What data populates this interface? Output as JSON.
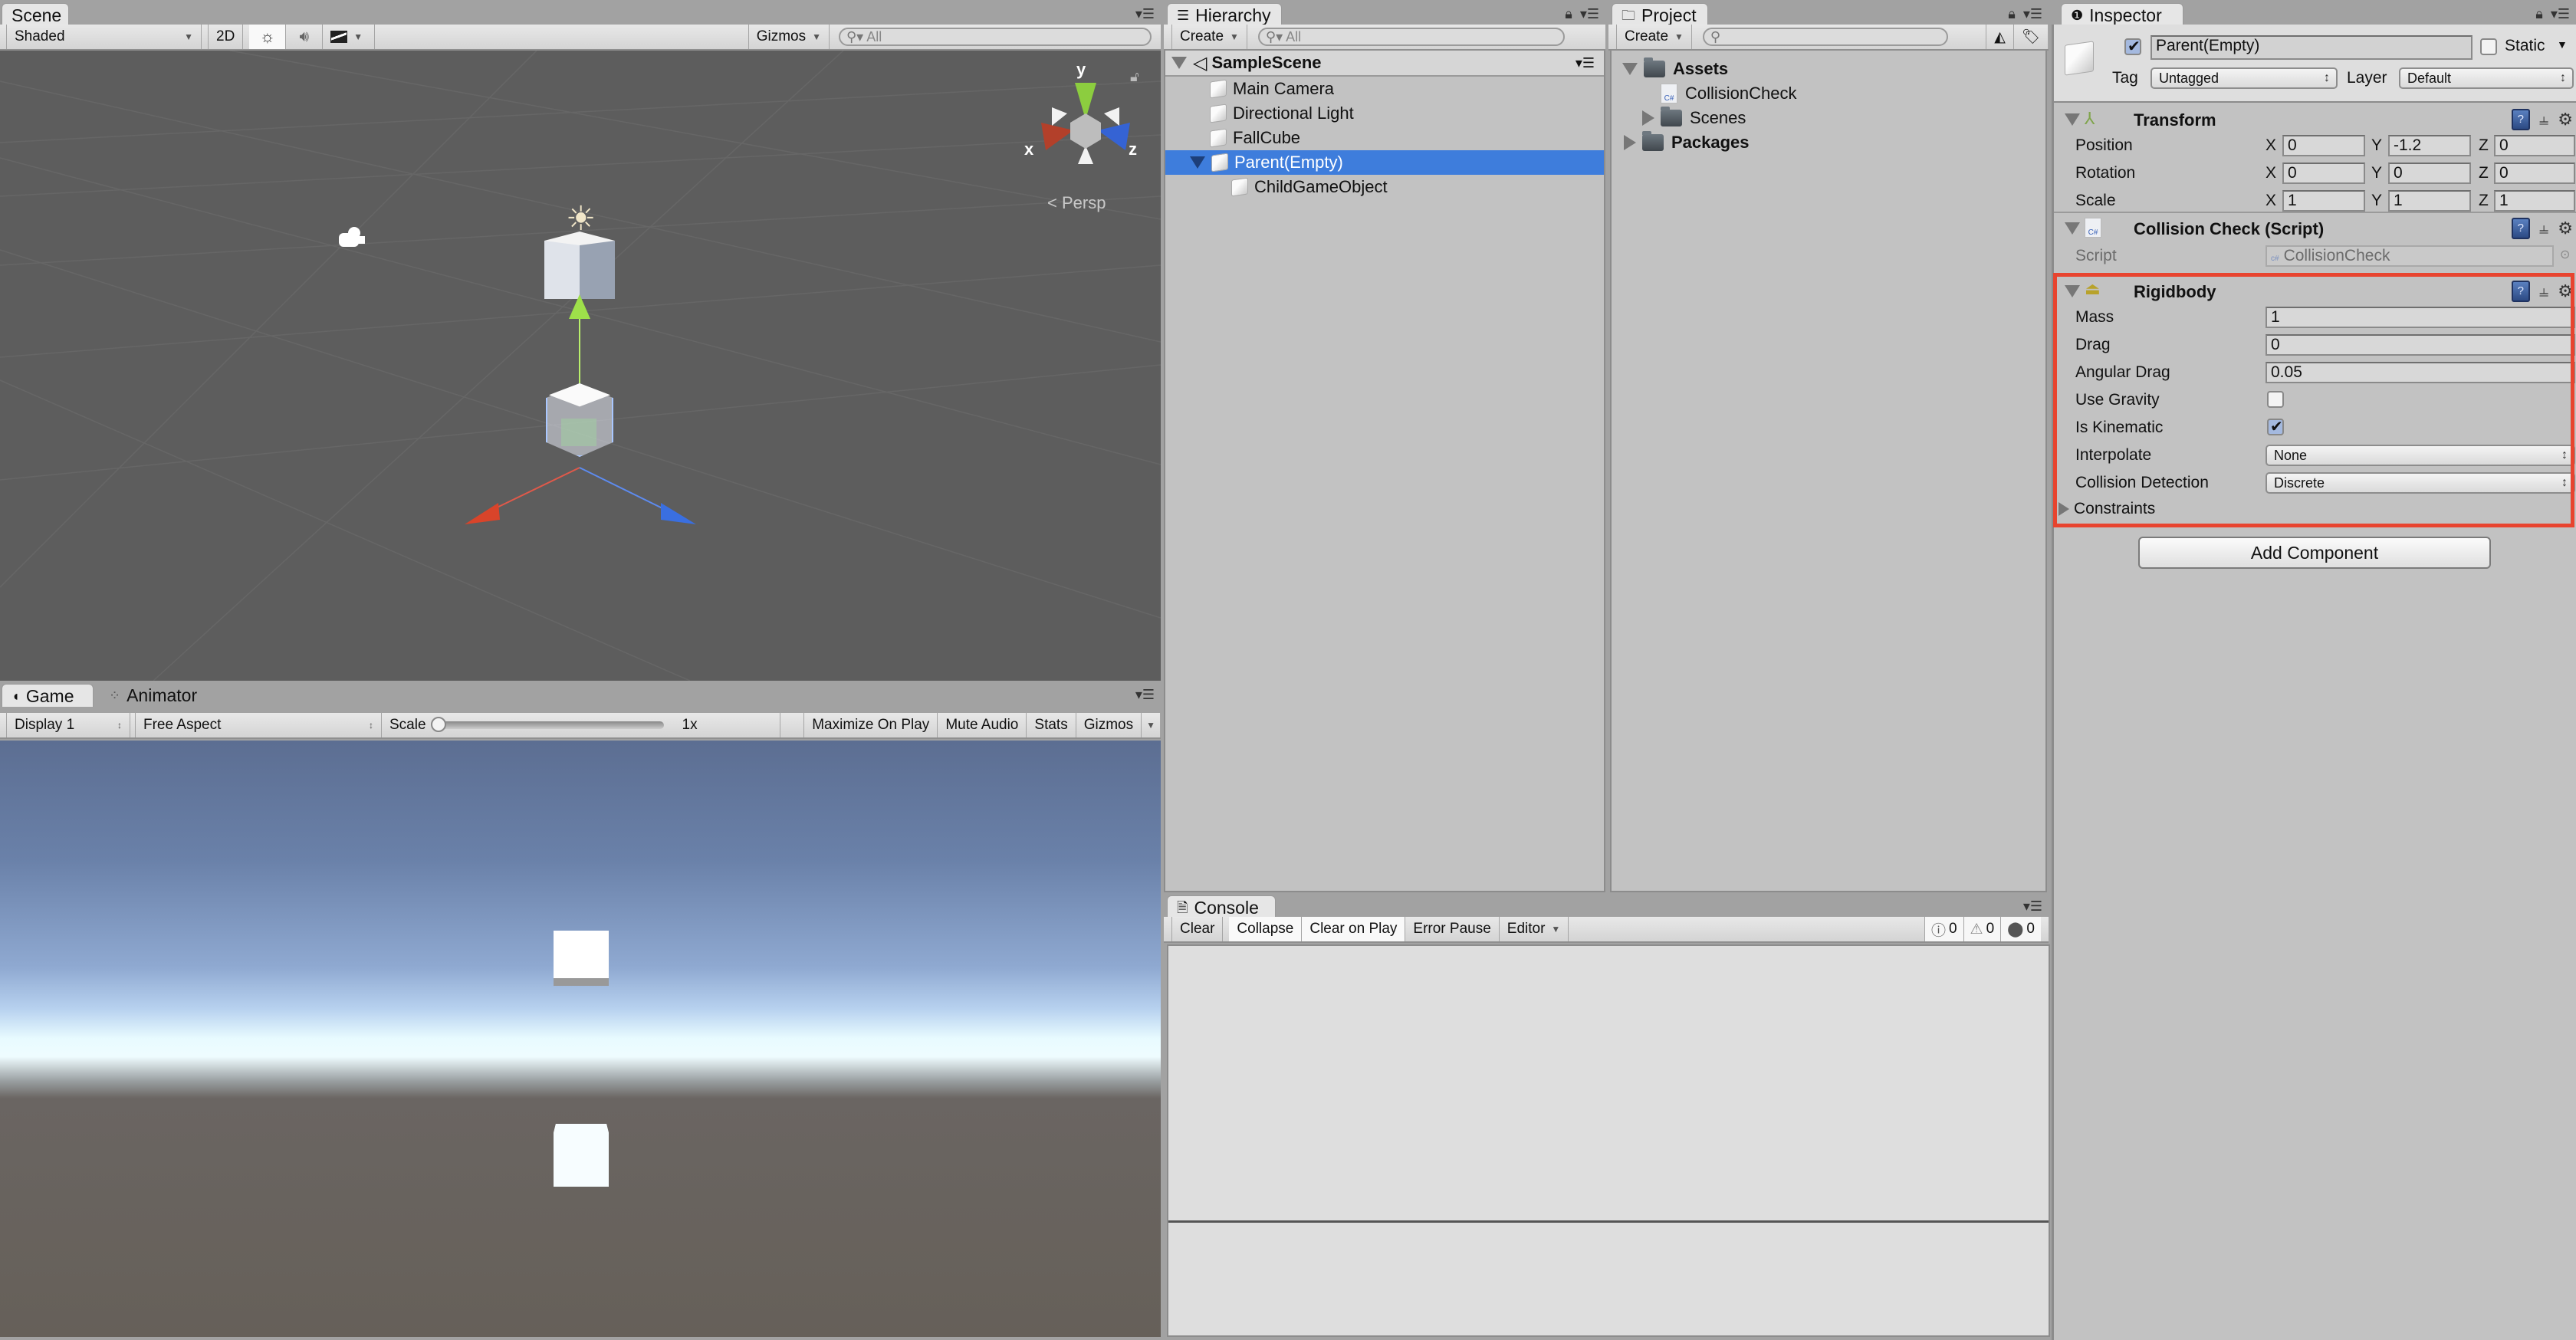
{
  "scene": {
    "tab": "Scene",
    "shading_mode": "Shaded",
    "toggle_2d": "2D",
    "gizmos": "Gizmos",
    "search_placeholder": "All",
    "axis_labels": {
      "x": "x",
      "y": "y",
      "z": "z"
    },
    "projection": "Persp"
  },
  "game": {
    "tabs": [
      {
        "label": "Game",
        "active": true
      },
      {
        "label": "Animator",
        "active": false
      }
    ],
    "display": "Display 1",
    "aspect": "Free Aspect",
    "scale_label": "Scale",
    "scale_value": "1x",
    "buttons": [
      "Maximize On Play",
      "Mute Audio",
      "Stats",
      "Gizmos"
    ]
  },
  "hierarchy": {
    "tab": "Hierarchy",
    "create": "Create",
    "search_placeholder": "All",
    "scene_name": "SampleScene",
    "items": [
      {
        "label": "Main Camera",
        "depth": 1,
        "selected": false
      },
      {
        "label": "Directional Light",
        "depth": 1,
        "selected": false
      },
      {
        "label": "FallCube",
        "depth": 1,
        "selected": false
      },
      {
        "label": "Parent(Empty)",
        "depth": 1,
        "selected": true,
        "expanded": true
      },
      {
        "label": "ChildGameObject",
        "depth": 2,
        "selected": false
      }
    ]
  },
  "project": {
    "tab": "Project",
    "create": "Create",
    "search_placeholder": "",
    "tree": [
      {
        "label": "Assets",
        "type": "folder",
        "bold": true,
        "expanded": true
      },
      {
        "label": "CollisionCheck",
        "type": "script",
        "bold": false
      },
      {
        "label": "Scenes",
        "type": "folder",
        "bold": false,
        "expanded": false
      },
      {
        "label": "Packages",
        "type": "folder",
        "bold": true,
        "expanded": false
      }
    ]
  },
  "console": {
    "tab": "Console",
    "buttons": [
      {
        "label": "Clear",
        "active": false
      },
      {
        "label": "Collapse",
        "active": true
      },
      {
        "label": "Clear on Play",
        "active": true
      },
      {
        "label": "Error Pause",
        "active": false
      },
      {
        "label": "Editor",
        "active": false
      }
    ],
    "counts": {
      "info": "0",
      "warning": "0",
      "error": "0"
    }
  },
  "inspector": {
    "tab": "Inspector",
    "object_active": true,
    "object_name": "Parent(Empty)",
    "static_label": "Static",
    "static": false,
    "tag_label": "Tag",
    "tag": "Untagged",
    "layer_label": "Layer",
    "layer": "Default",
    "transform": {
      "title": "Transform",
      "rows": [
        {
          "label": "Position",
          "x": "0",
          "y": "-1.2",
          "z": "0"
        },
        {
          "label": "Rotation",
          "x": "0",
          "y": "0",
          "z": "0"
        },
        {
          "label": "Scale",
          "x": "1",
          "y": "1",
          "z": "1"
        }
      ],
      "axis": {
        "x": "X",
        "y": "Y",
        "z": "Z"
      }
    },
    "script_component": {
      "title": "Collision Check (Script)",
      "script_label": "Script",
      "script_value": "CollisionCheck"
    },
    "rigidbody": {
      "title": "Rigidbody",
      "mass_label": "Mass",
      "mass": "1",
      "drag_label": "Drag",
      "drag": "0",
      "angular_drag_label": "Angular Drag",
      "angular_drag": "0.05",
      "use_gravity_label": "Use Gravity",
      "use_gravity": false,
      "is_kinematic_label": "Is Kinematic",
      "is_kinematic": true,
      "interpolate_label": "Interpolate",
      "interpolate": "None",
      "collision_label": "Collision Detection",
      "collision": "Discrete",
      "constraints_label": "Constraints"
    },
    "add_component": "Add Component",
    "highlight_color": "#e8442f"
  },
  "colors": {
    "selection": "#3e7ddc",
    "axis_x": "#d9442a",
    "axis_y": "#8fd43c",
    "axis_z": "#3a6fe0"
  }
}
